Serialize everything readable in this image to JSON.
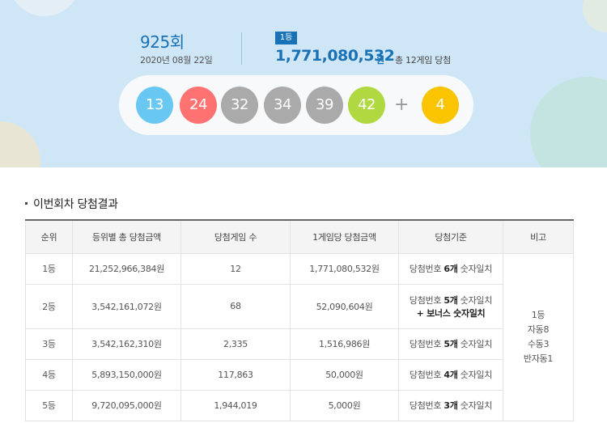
{
  "draw": {
    "round": "925",
    "round_suffix": "회",
    "date": "2020년 08월 22일",
    "rank_badge": "1등",
    "first_prize_amount": "1,771,080,532",
    "first_prize_unit": "원",
    "winner_text": "총 12게임 당첨",
    "plus_symbol": "+",
    "numbers": [
      {
        "value": "13",
        "color": "#69c8f2"
      },
      {
        "value": "24",
        "color": "#ff7272"
      },
      {
        "value": "32",
        "color": "#aaaaaa"
      },
      {
        "value": "34",
        "color": "#aaaaaa"
      },
      {
        "value": "39",
        "color": "#aaaaaa"
      },
      {
        "value": "42",
        "color": "#b0d840"
      }
    ],
    "bonus": {
      "value": "4",
      "color": "#fbc400"
    }
  },
  "results": {
    "section_title": "이번회차 당첨결과",
    "headers": [
      "순위",
      "등위별 총 당첨금액",
      "당첨게임 수",
      "1게임당 당첨금액",
      "당첨기준",
      "비고"
    ],
    "rows": [
      {
        "rank": "1등",
        "total": "21,252,966,384원",
        "games": "12",
        "per_game": "1,771,080,532원",
        "crit_prefix": "당첨번호 ",
        "crit_bold": "6개",
        "crit_suffix": " 숫자일치",
        "crit_line2": ""
      },
      {
        "rank": "2등",
        "total": "3,542,161,072원",
        "games": "68",
        "per_game": "52,090,604원",
        "crit_prefix": "당첨번호 ",
        "crit_bold": "5개",
        "crit_suffix": " 숫자일치",
        "crit_line2": "+ 보너스 숫자일치"
      },
      {
        "rank": "3등",
        "total": "3,542,162,310원",
        "games": "2,335",
        "per_game": "1,516,986원",
        "crit_prefix": "당첨번호 ",
        "crit_bold": "5개",
        "crit_suffix": " 숫자일치",
        "crit_line2": ""
      },
      {
        "rank": "4등",
        "total": "5,893,150,000원",
        "games": "117,863",
        "per_game": "50,000원",
        "crit_prefix": "당첨번호 ",
        "crit_bold": "4개",
        "crit_suffix": " 숫자일치",
        "crit_line2": ""
      },
      {
        "rank": "5등",
        "total": "9,720,095,000원",
        "games": "1,944,019",
        "per_game": "5,000원",
        "crit_prefix": "당첨번호 ",
        "crit_bold": "3개",
        "crit_suffix": " 숫자일치",
        "crit_line2": ""
      }
    ],
    "note_lines": [
      "1등",
      "자동8",
      "수동3",
      "반자동1"
    ]
  }
}
